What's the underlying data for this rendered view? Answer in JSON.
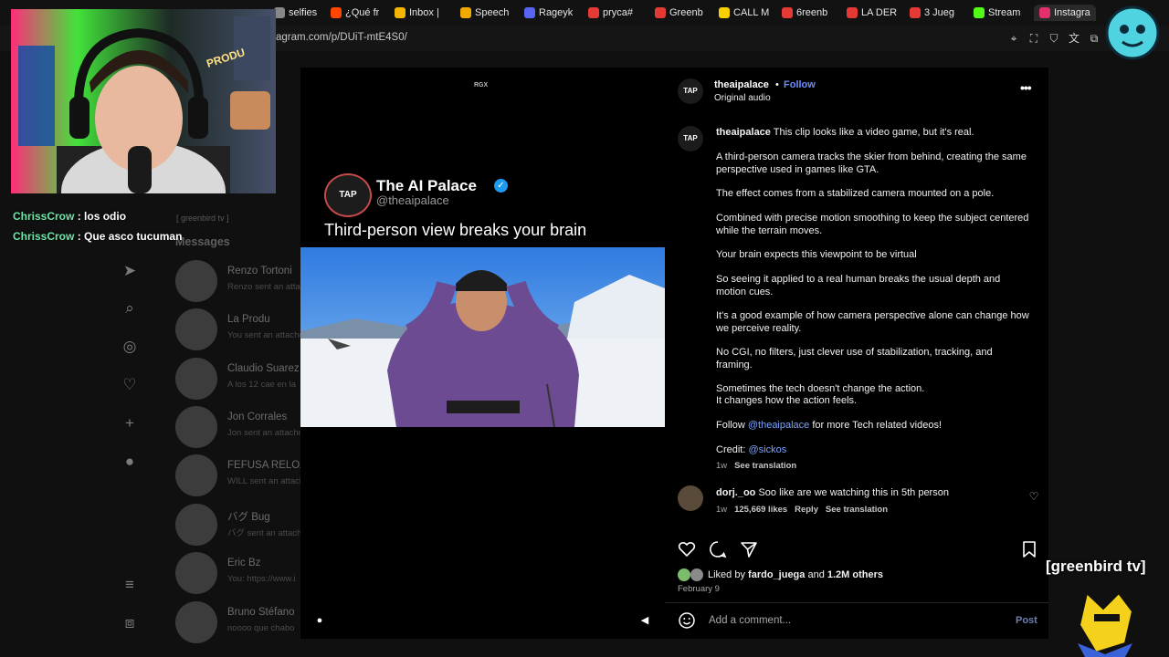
{
  "browser": {
    "tabs": [
      {
        "label": "selfies",
        "color": "#888888"
      },
      {
        "label": "¿Qué fr",
        "color": "#ff4500"
      },
      {
        "label": "Inbox |",
        "color": "#f4b400"
      },
      {
        "label": "Speech",
        "color": "#f2a900"
      },
      {
        "label": "Rageyk",
        "color": "#5865f2"
      },
      {
        "label": "pryca#",
        "color": "#e53935"
      },
      {
        "label": "Greenb",
        "color": "#e53935"
      },
      {
        "label": "CALL M",
        "color": "#f7d000"
      },
      {
        "label": "6reenb",
        "color": "#e53935"
      },
      {
        "label": "LA DER",
        "color": "#e53935"
      },
      {
        "label": "3 Jueg",
        "color": "#e53935"
      },
      {
        "label": "Stream",
        "color": "#53fc18"
      },
      {
        "label": "Instagra",
        "color": "#e1306c"
      }
    ],
    "url": "agram.com/p/DUiT-mtE4S0/"
  },
  "stream_chat": [
    {
      "user": "ChrissCrow",
      "text": ": los odio"
    },
    {
      "user": "ChrissCrow",
      "text": ": Que asco tucuman"
    }
  ],
  "webcam_badge": "PRODU",
  "background": {
    "messages_title": "Messages",
    "channel_label": "[ greenbird tv ]",
    "dms": [
      {
        "name": "Renzo Tortoni",
        "sub": "Renzo sent an attachment"
      },
      {
        "name": "La Produ",
        "sub": "You sent an attachment"
      },
      {
        "name": "Claudio Suarez",
        "sub": "A los 12 cae en la"
      },
      {
        "name": "Jon Corrales",
        "sub": "Jon sent an attachment"
      },
      {
        "name": "FEFUSA RELOAD",
        "sub": "WILL sent an attachment"
      },
      {
        "name": "バグ Bug",
        "sub": "バグ sent an attachment"
      },
      {
        "name": "Eric Bz",
        "sub": "You: https://www.i"
      },
      {
        "name": "Bruno Stéfano",
        "sub": "noooo que chabo"
      }
    ]
  },
  "post": {
    "media_watermark": "RGX",
    "tweet": {
      "logo": "TAP",
      "name": "The AI Palace",
      "handle": "@theaipalace",
      "headline": "Third-person view breaks your brain"
    },
    "author": "theaipalace",
    "follow_label": "Follow",
    "audio": "Original audio",
    "caption_intro": "This clip looks like a video game, but it's real.",
    "paragraphs": [
      "A third-person camera tracks the skier from behind, creating the same perspective used in games like GTA.",
      "The effect comes from a stabilized camera mounted on a pole.",
      "Combined with precise motion smoothing to keep the subject centered while the terrain moves.",
      "Your brain expects this viewpoint to be virtual",
      "So seeing it applied to a real human breaks the usual depth and motion cues.",
      "It's a good example of how camera perspective alone can change how we perceive reality.",
      "No CGI, no filters, just clever use of stabilization, tracking, and framing.",
      "Sometimes the tech doesn't change the action.",
      "It changes how the action feels."
    ],
    "follow_line_pre": "Follow",
    "follow_line_mention": "@theaipalace",
    "follow_line_post": "for more Tech related videos!",
    "credit_label": "Credit:",
    "credit_mention": "@sickos",
    "caption_time": "1w",
    "see_translation": "See translation",
    "comment": {
      "user": "dorj._oo",
      "text": "Soo like are we watching this in 5th person",
      "time": "1w",
      "likes": "125,669 likes",
      "reply": "Reply",
      "translate": "See translation"
    },
    "liked_by_label": "Liked by",
    "liked_by_user": "fardo_juega",
    "liked_by_rest": "and 1.2M others",
    "date": "February 9",
    "add_comment_placeholder": "Add a comment...",
    "post_button": "Post"
  },
  "stream_watermark": "[greenbird tv]"
}
